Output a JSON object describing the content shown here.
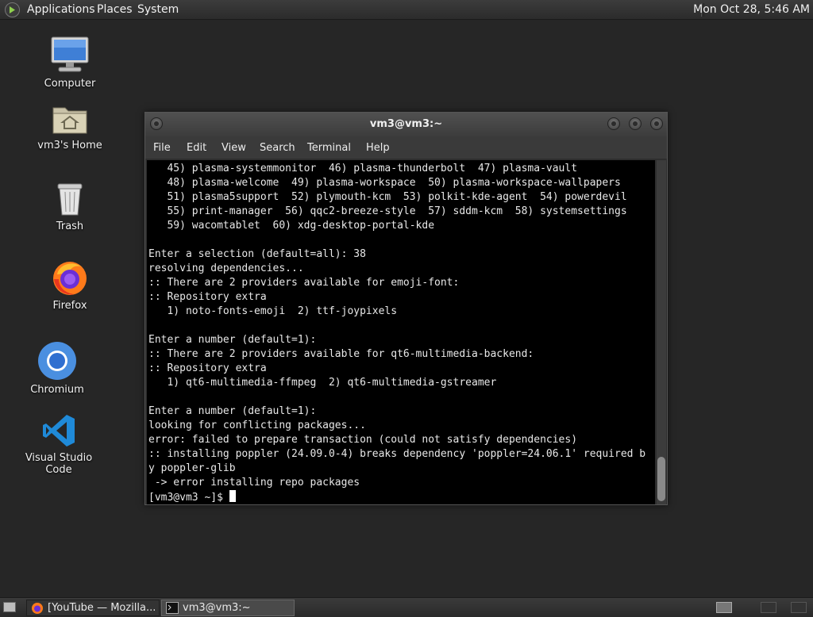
{
  "top_panel": {
    "menus": [
      "Applications",
      "Places",
      "System"
    ],
    "clock": "Mon Oct 28,  5:46 AM"
  },
  "desktop": {
    "icons": [
      {
        "label": "Computer",
        "icon": "computer-icon"
      },
      {
        "label": "vm3's Home",
        "icon": "home-folder-icon"
      },
      {
        "label": "Trash",
        "icon": "trash-icon"
      },
      {
        "label": "Firefox",
        "icon": "firefox-icon"
      },
      {
        "label": "Chromium",
        "icon": "chromium-icon"
      },
      {
        "label": "Visual Studio Code",
        "icon": "vscode-icon"
      }
    ]
  },
  "terminal": {
    "title": "vm3@vm3:~",
    "menu": [
      "File",
      "Edit",
      "View",
      "Search",
      "Terminal",
      "Help"
    ],
    "lines": [
      "   45) plasma-systemmonitor  46) plasma-thunderbolt  47) plasma-vault",
      "   48) plasma-welcome  49) plasma-workspace  50) plasma-workspace-wallpapers",
      "   51) plasma5support  52) plymouth-kcm  53) polkit-kde-agent  54) powerdevil",
      "   55) print-manager  56) qqc2-breeze-style  57) sddm-kcm  58) systemsettings",
      "   59) wacomtablet  60) xdg-desktop-portal-kde",
      "",
      "Enter a selection (default=all): 38",
      "resolving dependencies...",
      ":: There are 2 providers available for emoji-font:",
      ":: Repository extra",
      "   1) noto-fonts-emoji  2) ttf-joypixels",
      "",
      "Enter a number (default=1):",
      ":: There are 2 providers available for qt6-multimedia-backend:",
      ":: Repository extra",
      "   1) qt6-multimedia-ffmpeg  2) qt6-multimedia-gstreamer",
      "",
      "Enter a number (default=1):",
      "looking for conflicting packages...",
      "error: failed to prepare transaction (could not satisfy dependencies)",
      ":: installing poppler (24.09.0-4) breaks dependency 'poppler=24.06.1' required b",
      "y poppler-glib",
      " -> error installing repo packages"
    ],
    "prompt": "[vm3@vm3 ~]$ "
  },
  "taskbar": {
    "tasks": [
      {
        "label": "[YouTube — Mozilla...",
        "icon": "firefox-icon",
        "active": false
      },
      {
        "label": "vm3@vm3:~",
        "icon": "terminal-icon",
        "active": true
      }
    ]
  }
}
